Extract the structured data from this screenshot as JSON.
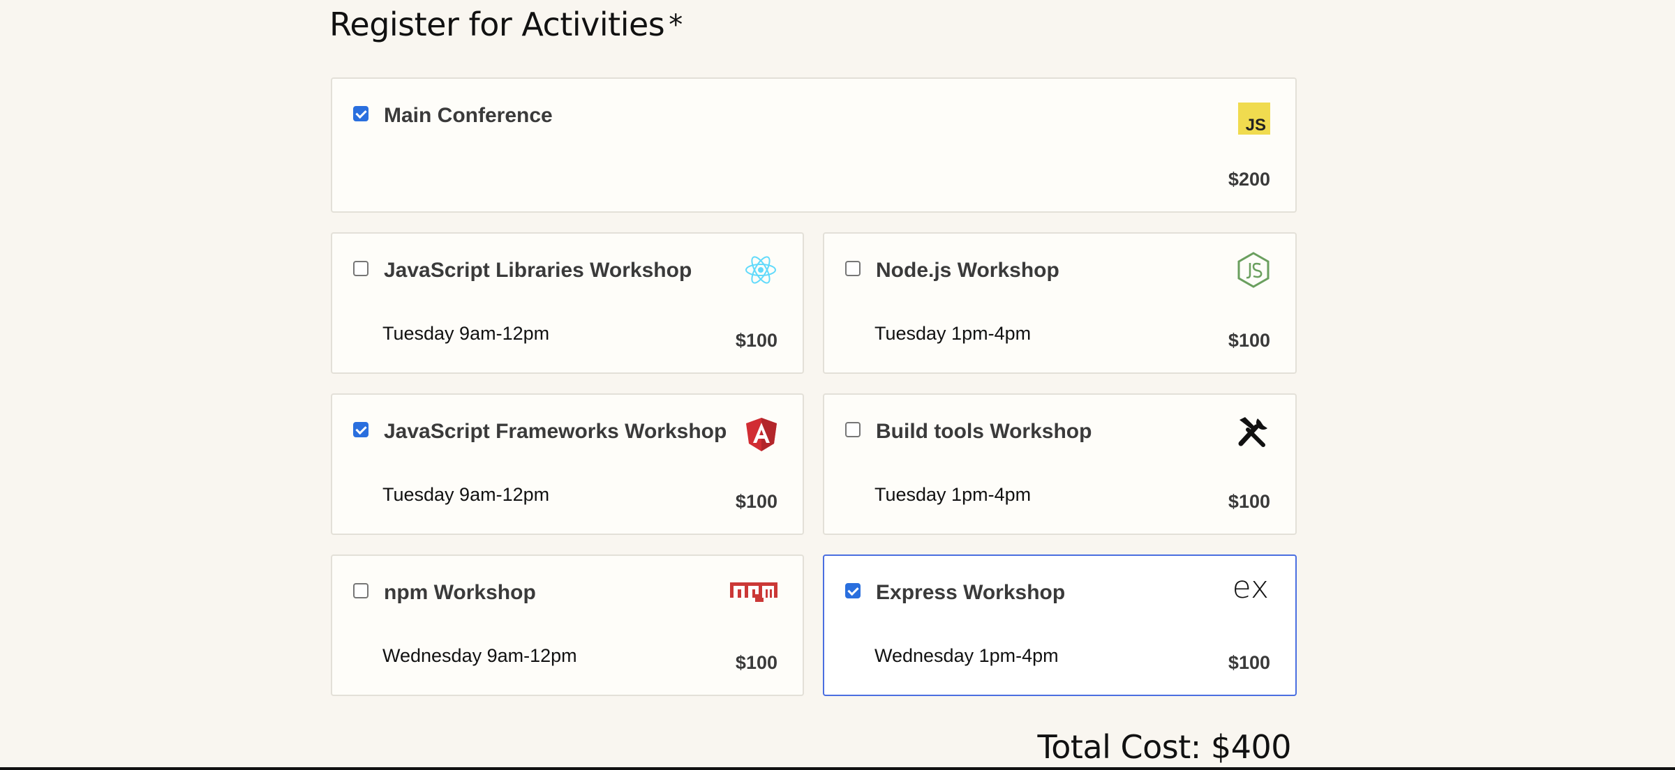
{
  "heading": {
    "title": "Register for Activities",
    "required_mark": "*"
  },
  "activities": [
    {
      "name": "Main Conference",
      "time": "",
      "price": "$200",
      "checked": true,
      "icon": "javascript-icon",
      "logo_text": "JS",
      "logo_color": "#f0db4f"
    },
    {
      "name": "JavaScript Libraries Workshop",
      "time": "Tuesday 9am-12pm",
      "price": "$100",
      "checked": false,
      "icon": "react-icon",
      "logo_color": "#61dafb"
    },
    {
      "name": "Node.js Workshop",
      "time": "Tuesday 1pm-4pm",
      "price": "$100",
      "checked": false,
      "icon": "nodejs-icon",
      "logo_color": "#6a9f5e"
    },
    {
      "name": "JavaScript Frameworks Workshop",
      "time": "Tuesday 9am-12pm",
      "price": "$100",
      "checked": true,
      "icon": "angular-icon",
      "logo_color": "#d12d33"
    },
    {
      "name": "Build tools Workshop",
      "time": "Tuesday 1pm-4pm",
      "price": "$100",
      "checked": false,
      "icon": "build-tools-icon",
      "logo_color": "#111111"
    },
    {
      "name": "npm Workshop",
      "time": "Wednesday 9am-12pm",
      "price": "$100",
      "checked": false,
      "icon": "npm-icon",
      "logo_text": "npm",
      "logo_color": "#cb3837"
    },
    {
      "name": "Express Workshop",
      "time": "Wednesday 1pm-4pm",
      "price": "$100",
      "checked": true,
      "icon": "express-icon",
      "logo_text": "ex",
      "logo_color": "#111111"
    }
  ],
  "total": {
    "label": "Total Cost: $400"
  },
  "colors": {
    "accent": "#2a6fde",
    "focus_border": "#4a6ee0",
    "page_bg": "#f9f6f0"
  }
}
